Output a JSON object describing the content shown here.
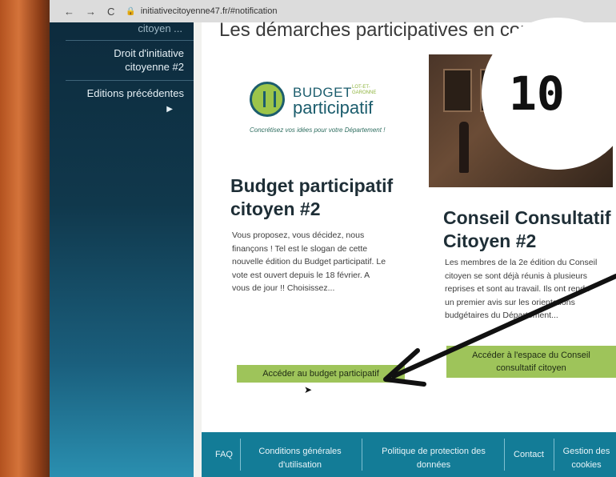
{
  "browser": {
    "back": "←",
    "forward": "→",
    "reload": "C",
    "url": "initiativecitoyenne47.fr/#notification"
  },
  "sidebar": {
    "cut_item": "citoyen ...",
    "items": [
      {
        "label_line1": "Droit d'initiative",
        "label_line2": "citoyenne #2"
      },
      {
        "label_line1": "Editions précédentes"
      }
    ]
  },
  "main": {
    "section_title": "Les démarches participatives en cours",
    "logo": {
      "word1": "BUDGET",
      "word2": "participatif",
      "small": "LOT-ET-GARONNE",
      "tagline": "Concrétisez vos idées pour votre Département !"
    },
    "cards": [
      {
        "title_line1": "Budget participatif",
        "title_line2": "citoyen #2",
        "text": [
          "Vous proposez, vous décidez, nous",
          "finançons ! Tel est le slogan de cette",
          "nouvelle édition du Budget participatif. Le",
          "vote est ouvert depuis le 18 février. A",
          "vous de jour !! Choisissez..."
        ],
        "button": "Accéder au budget participatif"
      },
      {
        "title_line1": "Conseil Consultatif",
        "title_line2": "Citoyen #2",
        "text": [
          "Les membres de la 2e édition du Conseil",
          "citoyen se sont déjà réunis à plusieurs",
          "reprises et sont au travail. Ils ont rendu",
          "un premier avis sur les orientations",
          "budgétaires du Département..."
        ],
        "button_line1": "Accéder à l'espace du Conseil",
        "button_line2": "consultatif citoyen"
      }
    ]
  },
  "footer": {
    "faq": "FAQ",
    "cgu_line1": "Conditions générales",
    "cgu_line2": "d'utilisation",
    "privacy_line1": "Politique de protection des",
    "privacy_line2": "données",
    "contact": "Contact",
    "cookies_line1": "Gestion des",
    "cookies_line2": "cookies"
  },
  "overlay": {
    "badge_number": "10",
    "arrow_color": "#111111"
  },
  "colors": {
    "accent_green": "#9ec45a",
    "footer_blue": "#137c97",
    "sidebar_dark": "#0d2b3d"
  }
}
